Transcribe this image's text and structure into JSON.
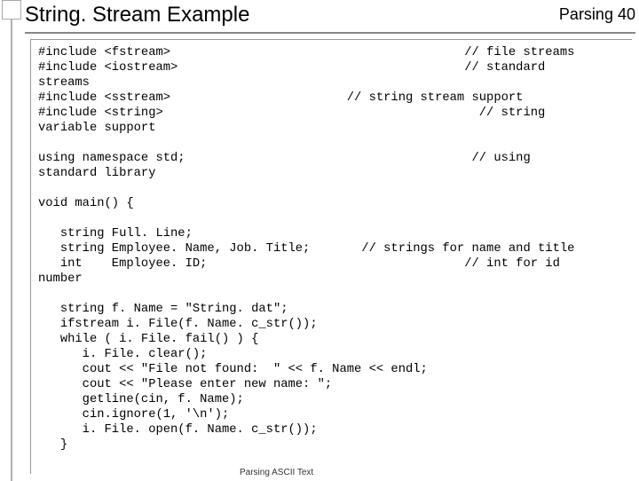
{
  "header": {
    "title": "String. Stream Example",
    "right_label": "Parsing",
    "page_number": "40"
  },
  "code": {
    "lines": [
      "#include <fstream>                                        // file streams",
      "#include <iostream>                                       // standard",
      "streams",
      "#include <sstream>                        // string stream support",
      "#include <string>                                           // string",
      "variable support",
      "",
      "using namespace std;                                       // using",
      "standard library",
      "",
      "void main() {",
      "",
      "   string Full. Line;",
      "   string Employee. Name, Job. Title;       // strings for name and title",
      "   int    Employee. ID;                                   // int for id",
      "number",
      "",
      "   string f. Name = \"String. dat\";",
      "   ifstream i. File(f. Name. c_str());",
      "   while ( i. File. fail() ) {",
      "      i. File. clear();",
      "      cout << \"File not found:  \" << f. Name << endl;",
      "      cout << \"Please enter new name: \";",
      "      getline(cin, f. Name);",
      "      cin.ignore(1, '\\n');",
      "      i. File. open(f. Name. c_str());",
      "   }"
    ]
  },
  "footer": {
    "text": "Parsing ASCII Text"
  }
}
